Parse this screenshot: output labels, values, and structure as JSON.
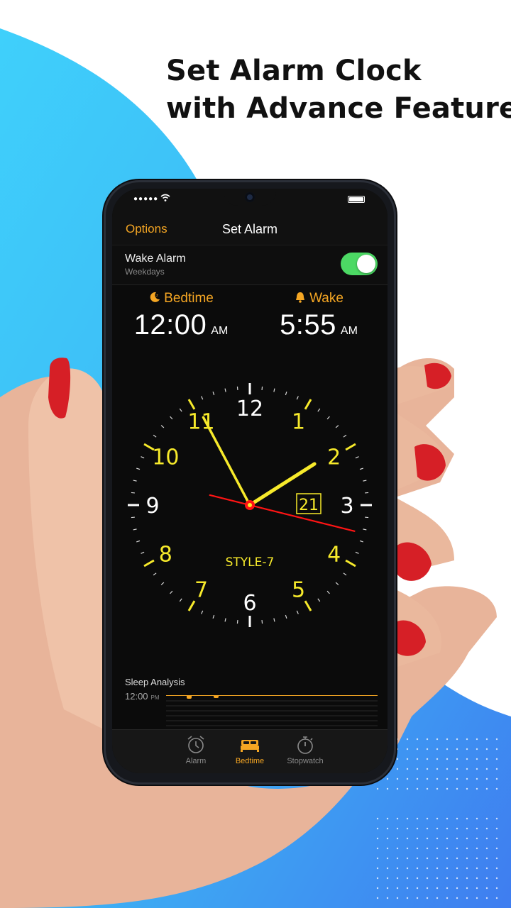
{
  "headline": {
    "line1": "Set Alarm Clock",
    "line2": "with Advance Features"
  },
  "colors": {
    "accent": "#f5a623",
    "toggle_on": "#4cd964",
    "clock_yellow": "#f7ea2b",
    "second_hand": "#ff1414",
    "bg_blue": "#3fc3f7"
  },
  "nav": {
    "options_label": "Options",
    "title": "Set Alarm"
  },
  "wake_alarm": {
    "label": "Wake Alarm",
    "schedule": "Weekdays",
    "enabled": true
  },
  "bedtime": {
    "label": "Bedtime",
    "time": "12:00",
    "ampm": "AM",
    "icon": "moon-icon"
  },
  "wake": {
    "label": "Wake",
    "time": "5:55",
    "ampm": "AM",
    "icon": "bell-icon"
  },
  "clock": {
    "numbers": [
      "12",
      "1",
      "2",
      "3",
      "4",
      "5",
      "6",
      "7",
      "8",
      "9",
      "10",
      "11"
    ],
    "date": "21",
    "style": "STYLE-7",
    "hour": 1,
    "minute": 55,
    "second": 21
  },
  "sleep_analysis": {
    "title": "Sleep Analysis",
    "time": "12:00",
    "ampm": "PM"
  },
  "tabs": [
    {
      "label": "Alarm",
      "icon": "alarm-clock-icon",
      "active": false
    },
    {
      "label": "Bedtime",
      "icon": "bed-icon",
      "active": true
    },
    {
      "label": "Stopwatch",
      "icon": "stopwatch-icon",
      "active": false
    }
  ]
}
